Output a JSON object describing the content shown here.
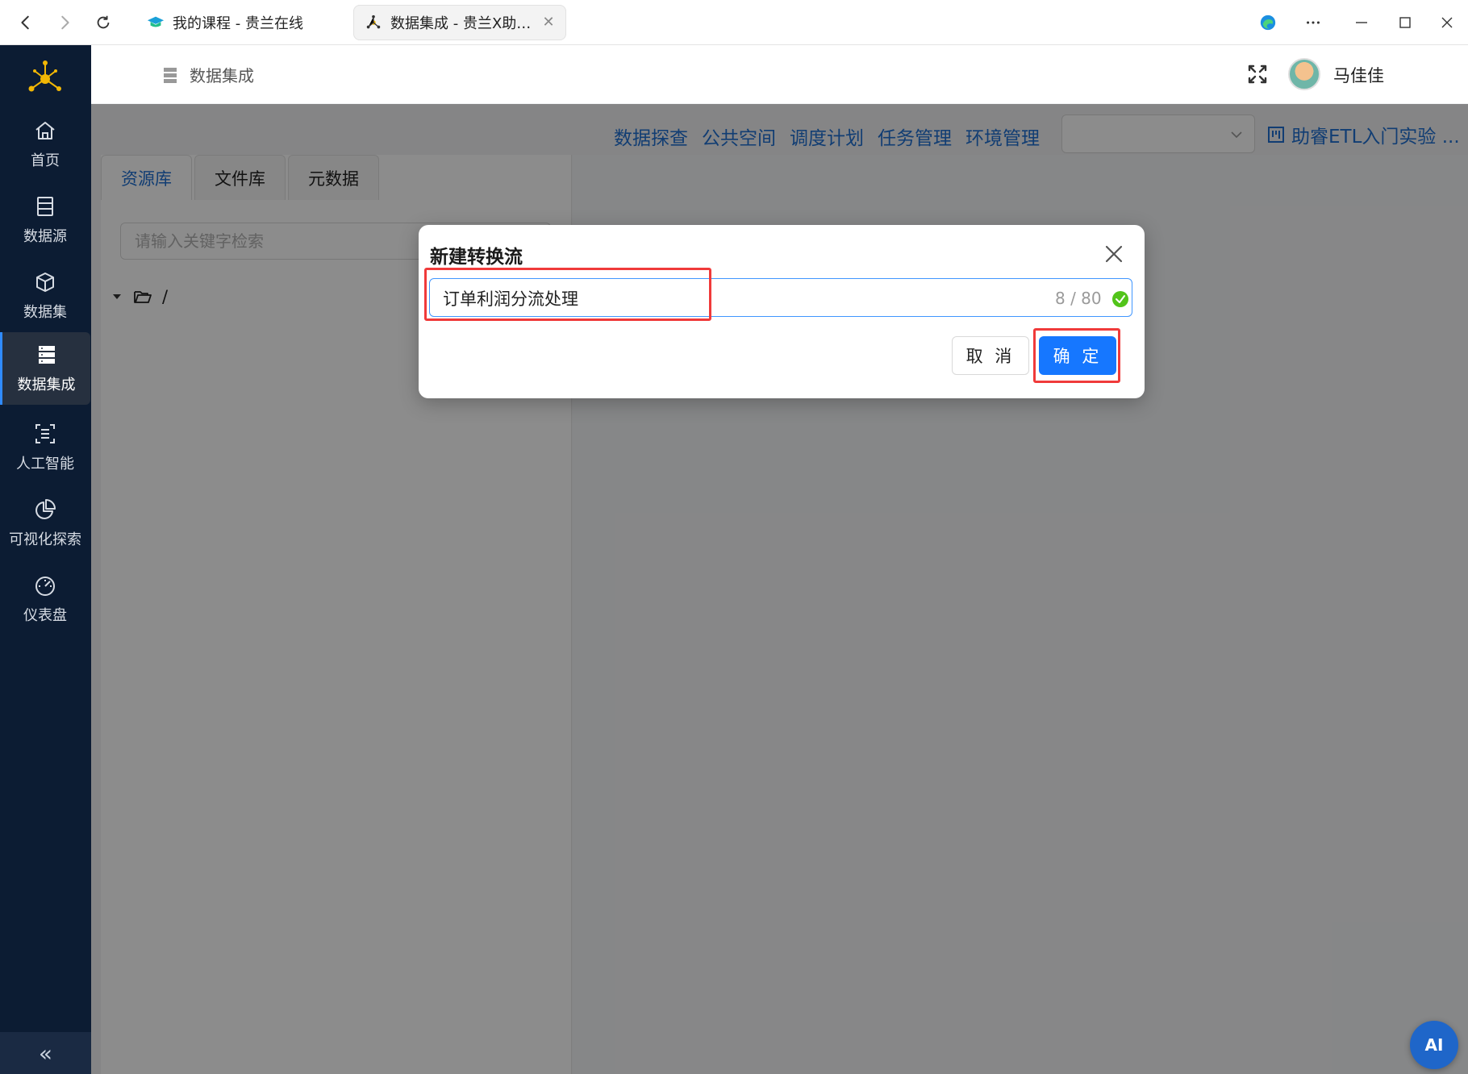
{
  "browser": {
    "tabs": [
      {
        "label": "我的课程 - 贵兰在线",
        "active": false
      },
      {
        "label": "数据集成 - 贵兰X助睿...",
        "active": true
      }
    ]
  },
  "sidebar": {
    "items": [
      {
        "label": "首页",
        "icon": "home-icon"
      },
      {
        "label": "数据源",
        "icon": "datasource-icon"
      },
      {
        "label": "数据集",
        "icon": "cube-icon"
      },
      {
        "label": "数据集成",
        "icon": "server-icon",
        "active": true
      },
      {
        "label": "人工智能",
        "icon": "ai-icon"
      },
      {
        "label": "可视化探索",
        "icon": "pie-icon"
      },
      {
        "label": "仪表盘",
        "icon": "gauge-icon"
      }
    ],
    "collapse_glyph": "«"
  },
  "header": {
    "breadcrumb": "数据集成",
    "user_name": "马佳佳"
  },
  "toolbar": {
    "links": [
      "数据探查",
      "公共空间",
      "调度计划",
      "任务管理",
      "环境管理"
    ],
    "project_label": "助睿ETL入门实验 ..."
  },
  "resource_panel": {
    "tabs": [
      {
        "label": "资源库",
        "active": true
      },
      {
        "label": "文件库",
        "active": false
      },
      {
        "label": "元数据",
        "active": false
      }
    ],
    "search_placeholder": "请输入关键字检索",
    "tree_root": "/"
  },
  "dialog": {
    "title": "新建转换流",
    "name_value": "订单利润分流处理",
    "counter": "8 / 80",
    "cancel_label": "取 消",
    "ok_label": "确 定"
  },
  "ai_button": "AI",
  "colors": {
    "sidebar_bg": "#0c1c33",
    "accent": "#1677ff",
    "link": "#1f6fd1",
    "highlight": "#f03a3a",
    "success": "#52c41a"
  }
}
